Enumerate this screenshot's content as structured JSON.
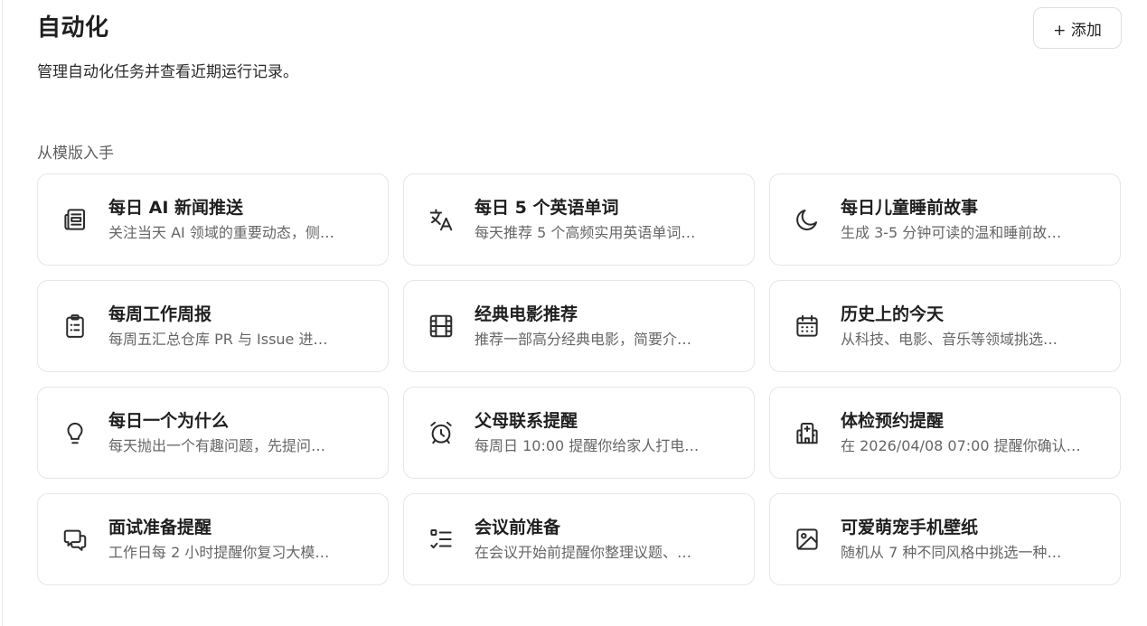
{
  "header": {
    "title": "自动化",
    "subtitle": "管理自动化任务并查看近期运行记录。",
    "add_label": "+ 添加"
  },
  "templates_section": {
    "label": "从模版入手",
    "cards": [
      {
        "icon": "newspaper-icon",
        "title": "每日 AI 新闻推送",
        "desc": "关注当天 AI 领域的重要动态，侧…"
      },
      {
        "icon": "translate-icon",
        "title": "每日 5 个英语单词",
        "desc": "每天推荐 5 个高频实用英语单词…"
      },
      {
        "icon": "moon-icon",
        "title": "每日儿童睡前故事",
        "desc": "生成 3-5 分钟可读的温和睡前故…"
      },
      {
        "icon": "clipboard-list-icon",
        "title": "每周工作周报",
        "desc": "每周五汇总仓库 PR 与 Issue 进…"
      },
      {
        "icon": "film-icon",
        "title": "经典电影推荐",
        "desc": "推荐一部高分经典电影，简要介…"
      },
      {
        "icon": "calendar-icon",
        "title": "历史上的今天",
        "desc": "从科技、电影、音乐等领域挑选…"
      },
      {
        "icon": "lightbulb-icon",
        "title": "每日一个为什么",
        "desc": "每天抛出一个有趣问题，先提问…"
      },
      {
        "icon": "alarm-clock-icon",
        "title": "父母联系提醒",
        "desc": "每周日 10:00 提醒你给家人打电…"
      },
      {
        "icon": "hospital-icon",
        "title": "体检预约提醒",
        "desc": "在 2026/04/08 07:00 提醒你确认…"
      },
      {
        "icon": "chat-bubbles-icon",
        "title": "面试准备提醒",
        "desc": "工作日每 2 小时提醒你复习大模…"
      },
      {
        "icon": "checklist-icon",
        "title": "会议前准备",
        "desc": "在会议开始前提醒你整理议题、…"
      },
      {
        "icon": "image-icon",
        "title": "可爱萌宠手机壁纸",
        "desc": "随机从 7 种不同风格中挑选一种…"
      }
    ]
  }
}
